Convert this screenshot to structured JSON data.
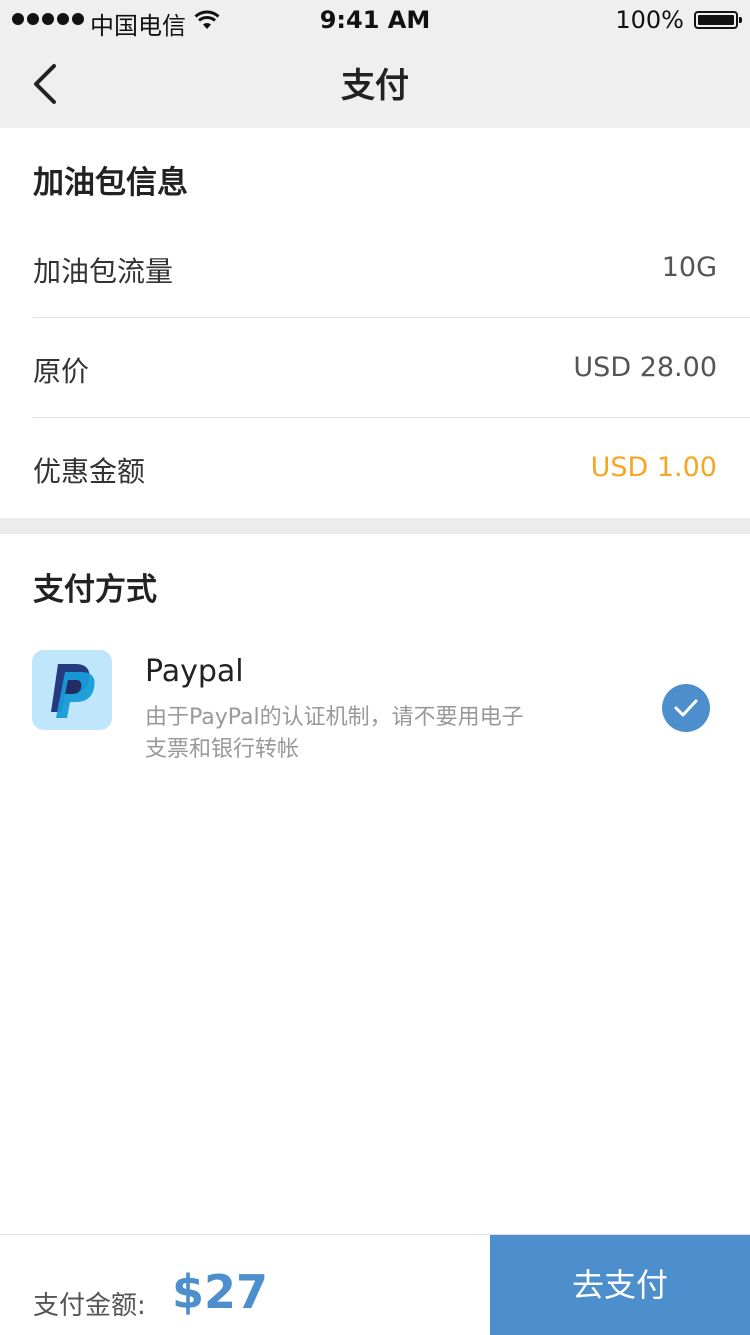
{
  "status_bar": {
    "carrier": "中国电信",
    "time": "9:41 AM",
    "battery": "100%"
  },
  "nav": {
    "title": "支付",
    "back_icon": "chevron-left-icon"
  },
  "package_info": {
    "title": "加油包信息",
    "rows": [
      {
        "label": "加油包流量",
        "value": "10G"
      },
      {
        "label": "原价",
        "value": "USD 28.00"
      },
      {
        "label": "优惠金额",
        "value": "USD 1.00"
      }
    ],
    "discount_color": "#f5a623"
  },
  "payment": {
    "title": "支付方式",
    "methods": [
      {
        "name": "Paypal",
        "description": "由于PayPal的认证机制，请不要用电子支票和银行转帐",
        "icon": "paypal-icon",
        "selected": true
      }
    ]
  },
  "footer": {
    "total_label": "支付金额:",
    "total_amount": "$27",
    "pay_button_label": "去支付"
  },
  "colors": {
    "accent": "#4d8fcc",
    "background_gray": "#efefef"
  }
}
